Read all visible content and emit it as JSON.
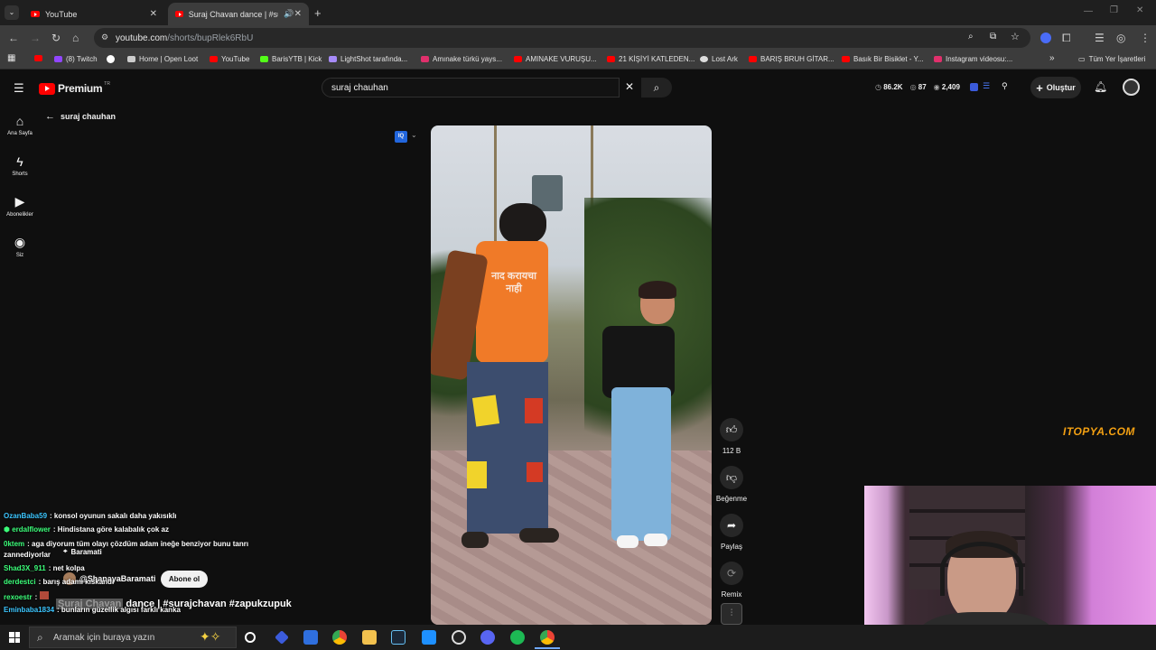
{
  "browser": {
    "tabs": [
      {
        "label": "YouTube"
      },
      {
        "label": "Suraj Chavan dance | #suraj"
      }
    ],
    "url_host": "youtube.com",
    "url_path": "/shorts/bupRlek6RbU",
    "bookmarks": [
      {
        "label": "(8) Twitch",
        "color": "#9146ff"
      },
      {
        "label": "Home | Open Loot",
        "color": "#cccccc"
      },
      {
        "label": "YouTube",
        "color": "#ff0000"
      },
      {
        "label": "BarisYTB | Kick",
        "color": "#53fc18"
      },
      {
        "label": "LightShot tarafında...",
        "color": "#a78bfa"
      },
      {
        "label": "Amınake türkü yays...",
        "color": "#e1306c"
      },
      {
        "label": "AMINAKE VURUŞU...",
        "color": "#ff0000"
      },
      {
        "label": "21 KİŞİYİ KATLEDEN...",
        "color": "#ff0000"
      },
      {
        "label": "Lost Ark",
        "color": "#dddddd"
      },
      {
        "label": "BARIŞ BRUH GİTAR...",
        "color": "#ff0000"
      },
      {
        "label": "Basık Bir Bisiklet - Y...",
        "color": "#ff0000"
      },
      {
        "label": "Instagram videosu:...",
        "color": "#e1306c"
      }
    ],
    "all_bookmarks": "Tüm Yer İşaretleri"
  },
  "youtube": {
    "logo": "Premium",
    "logo_sup": "TR",
    "search_value": "suraj chauhan",
    "stats": [
      "86.2K",
      "87",
      "2,409"
    ],
    "create_label": "Oluştur",
    "sidebar": [
      {
        "label": "Ana Sayfa",
        "icon": "home-icon"
      },
      {
        "label": "Shorts",
        "icon": "shorts-icon"
      },
      {
        "label": "Abonelikler",
        "icon": "subscriptions-icon"
      },
      {
        "label": "Siz",
        "icon": "you-icon"
      }
    ],
    "back_label": "suraj chauhan",
    "shirt_text": "नाद करायचा नाही",
    "actions": {
      "like_count": "112 B",
      "dislike_label": "Beğenme",
      "share_label": "Paylaş",
      "remix_label": "Remix"
    },
    "video_overlay": {
      "location": "Baramati",
      "channel": "@ShanayaBaramati",
      "subscribe": "Abone ol",
      "title_prefix": "Suraj Chavan",
      "title_rest": "dance | #surajchavan #zapukzupuk"
    },
    "watermark": "ITOPYA.COM"
  },
  "chat": [
    {
      "user": "OzanBaba59",
      "color": "#3cc6ff",
      "text": ": konsol oyunun sakalı daha yakısıklı"
    },
    {
      "user": "erdalflower",
      "color": "#3cff7a",
      "text": ": Hindistana göre kalabalık çok az"
    },
    {
      "user": "0ktem",
      "color": "#3cff7a",
      "text": ": aga diyorum tüm olayı çözdüm adam ineğe benziyor bunu tanrı"
    },
    {
      "user": "",
      "color": "#ffffff",
      "text": "zannediyorlar"
    },
    {
      "user": "Shad3X_911",
      "color": "#3cff7a",
      "text": ": net kolpa"
    },
    {
      "user": "derdestci",
      "color": "#3cff7a",
      "text": ": barış adamı kıskandı"
    },
    {
      "user": "rexoestr",
      "color": "#3cff7a",
      "text": ":"
    },
    {
      "user": "Eminbaba1834",
      "color": "#3cc6ff",
      "text": ": bunların güzellik algısı farklı kanka"
    }
  ],
  "taskbar": {
    "search_placeholder": "Aramak için buraya yazın"
  }
}
